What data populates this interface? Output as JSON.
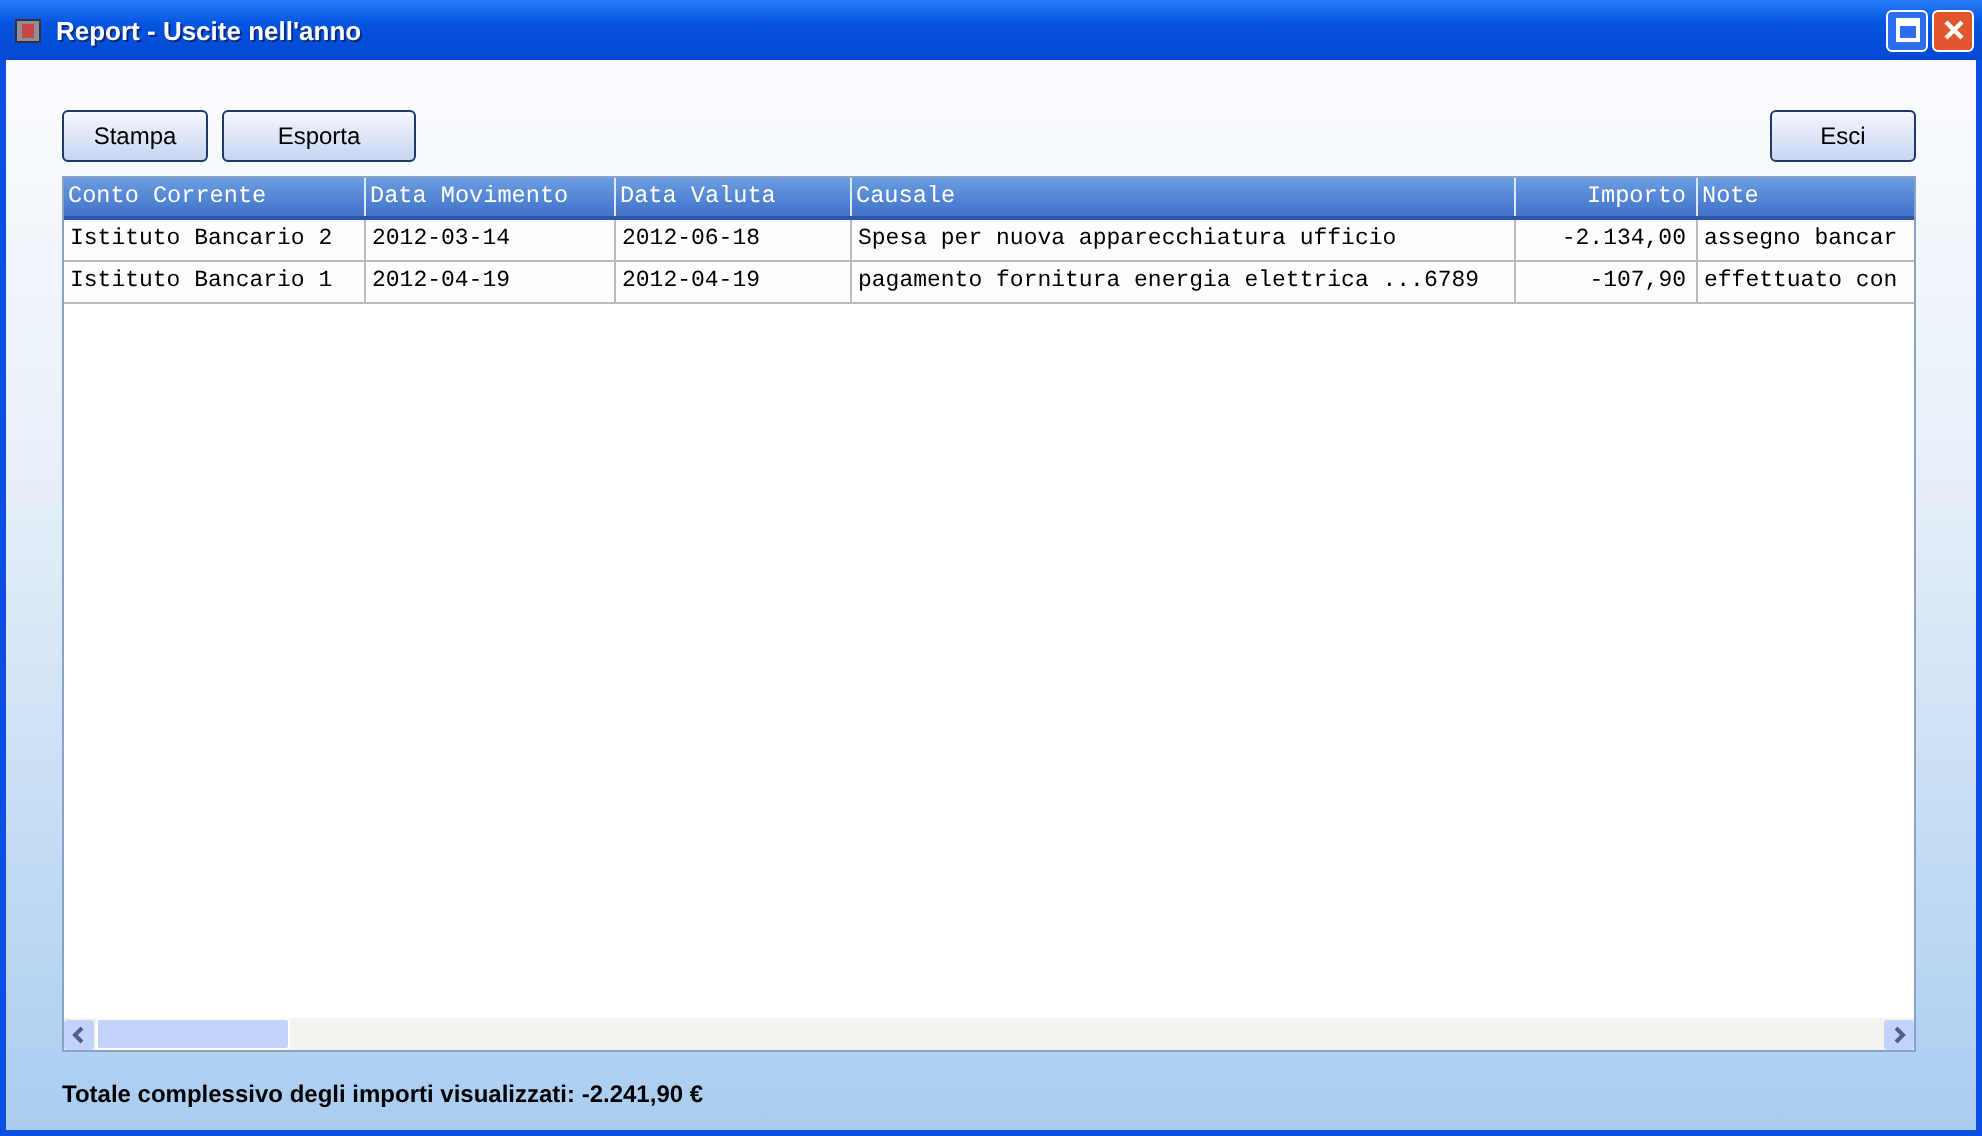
{
  "window": {
    "title": "Report - Uscite nell'anno"
  },
  "toolbar": {
    "left_buttons": [
      "Stampa",
      "Esporta"
    ],
    "right_buttons": [
      "Esci"
    ]
  },
  "table": {
    "columns": [
      {
        "label": "Conto Corrente",
        "kind": "text"
      },
      {
        "label": "Data Movimento",
        "kind": "text"
      },
      {
        "label": "Data Valuta",
        "kind": "text"
      },
      {
        "label": "Causale",
        "kind": "text"
      },
      {
        "label": "Importo",
        "kind": "amount"
      },
      {
        "label": "Note",
        "kind": "text"
      }
    ],
    "rows": [
      [
        "Istituto Bancario 2",
        "2012-03-14",
        "2012-06-18",
        "Spesa per nuova apparecchiatura ufficio",
        "-2.134,00",
        "assegno bancar"
      ],
      [
        "Istituto Bancario 1",
        "2012-04-19",
        "2012-04-19",
        "pagamento fornitura energia elettrica ...6789",
        "-107,90",
        "effettuato con"
      ]
    ]
  },
  "total": "Totale complessivo degli importi visualizzati: -2.241,90 €"
}
